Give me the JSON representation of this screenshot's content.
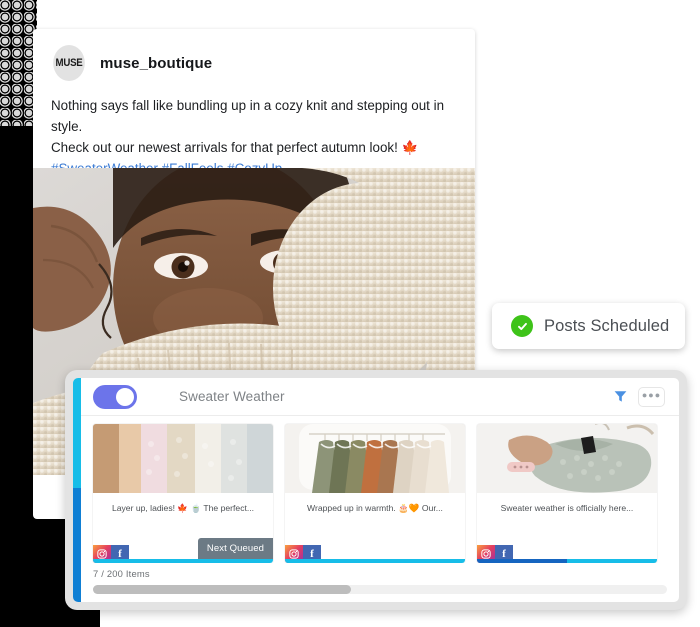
{
  "post": {
    "avatar_initials": "MUSE",
    "username": "muse_boutique",
    "caption_line1": "Nothing says fall like bundling up in a cozy knit and stepping out in style.",
    "caption_line2": "Check out our newest arrivals for that perfect autumn look! 🍁",
    "hashtags": "#SweaterWeather #FallFeels #CozyUp",
    "image_alt": "person wrapped in cream knit sweater"
  },
  "badge": {
    "icon": "check-circle-icon",
    "label": "Posts Scheduled",
    "color": "#3ec319"
  },
  "scheduler": {
    "toggle_on": true,
    "toggle_color": "#6c74ea",
    "title": "Sweater Weather",
    "filter_icon": "filter-funnel-icon",
    "filter_color": "#4a90e2",
    "more_menu_label": "●●●",
    "accent_top_color": "#17bde8",
    "accent_bottom_color": "#0f7fd4",
    "item_count": "7 / 200 Items",
    "scroll_position_pct": 45,
    "cards": [
      {
        "caption": "Layer up, ladies! 🍁 🍵 The perfect...",
        "networks": [
          "instagram",
          "facebook"
        ],
        "badge": "Next Queued",
        "progress_segments": [
          {
            "color": "#17bde8",
            "pct": 100
          }
        ],
        "image_alt": "stack of folded knit sweaters"
      },
      {
        "caption": "Wrapped up in warmth. 🎂🧡 Our...",
        "networks": [
          "instagram",
          "facebook"
        ],
        "badge": "",
        "progress_segments": [
          {
            "color": "#17bde8",
            "pct": 100
          }
        ],
        "image_alt": "clothing rack with sweaters on hangers"
      },
      {
        "caption": "Sweater weather is officially here...",
        "networks": [
          "instagram",
          "facebook"
        ],
        "badge": "",
        "progress_segments": [
          {
            "color": "#1565c0",
            "pct": 50
          },
          {
            "color": "#17bde8",
            "pct": 50
          }
        ],
        "image_alt": "hands holding grey knit sweater on hanger"
      }
    ]
  }
}
